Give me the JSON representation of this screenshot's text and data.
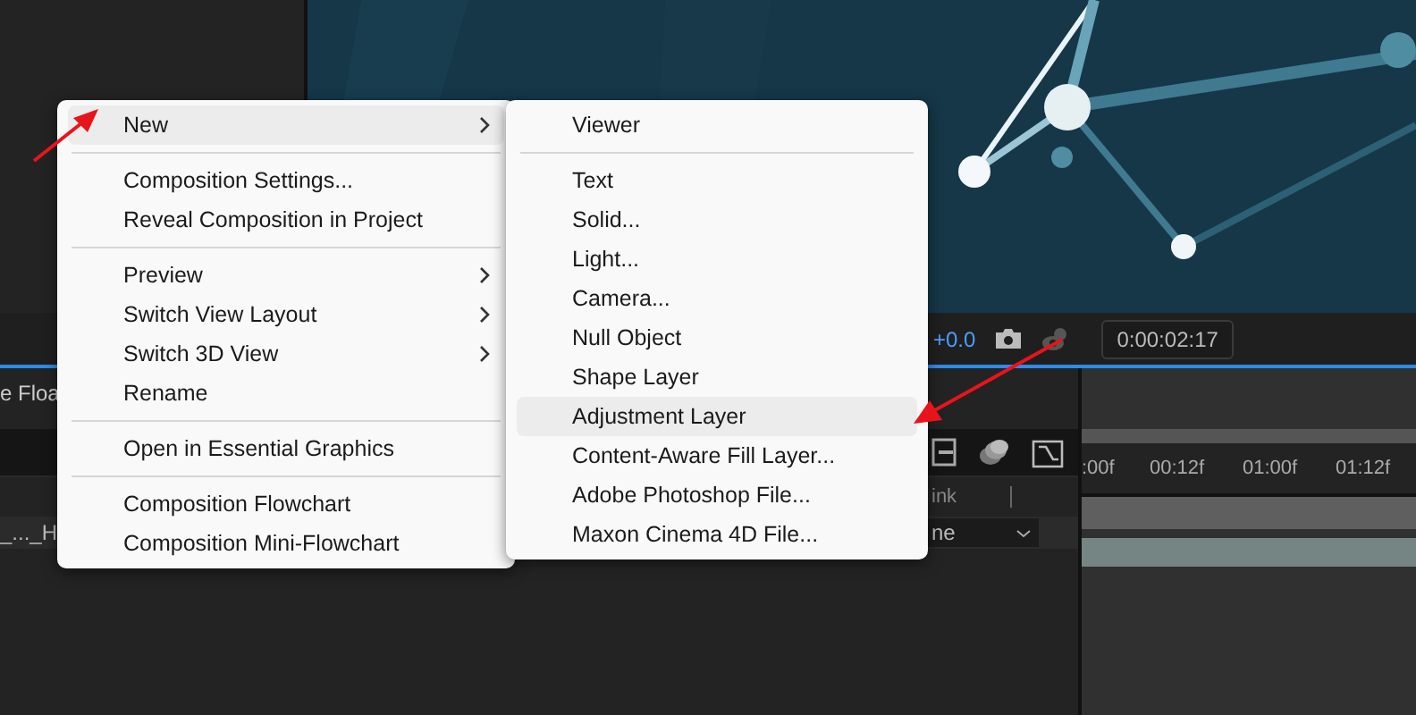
{
  "viewer_toolbar": {
    "exposure": "+0.0",
    "timecode": "0:00:02:17"
  },
  "timeline": {
    "tab_title": "e Floa",
    "layer_name": "_..._H",
    "column_header": "ink",
    "mode_value": "ne",
    "ruler_labels": [
      ":00f",
      "00:12f",
      "01:00f",
      "01:12f"
    ]
  },
  "context_menu": {
    "groups": [
      [
        {
          "label": "New",
          "submenu": true,
          "selected": true
        }
      ],
      [
        {
          "label": "Composition Settings...",
          "submenu": false,
          "selected": false
        },
        {
          "label": "Reveal Composition in Project",
          "submenu": false,
          "selected": false
        }
      ],
      [
        {
          "label": "Preview",
          "submenu": true,
          "selected": false
        },
        {
          "label": "Switch View Layout",
          "submenu": true,
          "selected": false
        },
        {
          "label": "Switch 3D View",
          "submenu": true,
          "selected": false
        },
        {
          "label": "Rename",
          "submenu": false,
          "selected": false
        }
      ],
      [
        {
          "label": "Open in Essential Graphics",
          "submenu": false,
          "selected": false
        }
      ],
      [
        {
          "label": "Composition Flowchart",
          "submenu": false,
          "selected": false
        },
        {
          "label": "Composition Mini-Flowchart",
          "submenu": false,
          "selected": false
        }
      ]
    ]
  },
  "submenu": {
    "groups": [
      [
        {
          "label": "Viewer",
          "selected": false
        }
      ],
      [
        {
          "label": "Text",
          "selected": false
        },
        {
          "label": "Solid...",
          "selected": false
        },
        {
          "label": "Light...",
          "selected": false
        },
        {
          "label": "Camera...",
          "selected": false
        },
        {
          "label": "Null Object",
          "selected": false
        },
        {
          "label": "Shape Layer",
          "selected": false
        },
        {
          "label": "Adjustment Layer",
          "selected": true
        },
        {
          "label": "Content-Aware Fill Layer...",
          "selected": false
        },
        {
          "label": "Adobe Photoshop File...",
          "selected": false
        },
        {
          "label": "Maxon Cinema 4D File...",
          "selected": false
        }
      ]
    ]
  }
}
